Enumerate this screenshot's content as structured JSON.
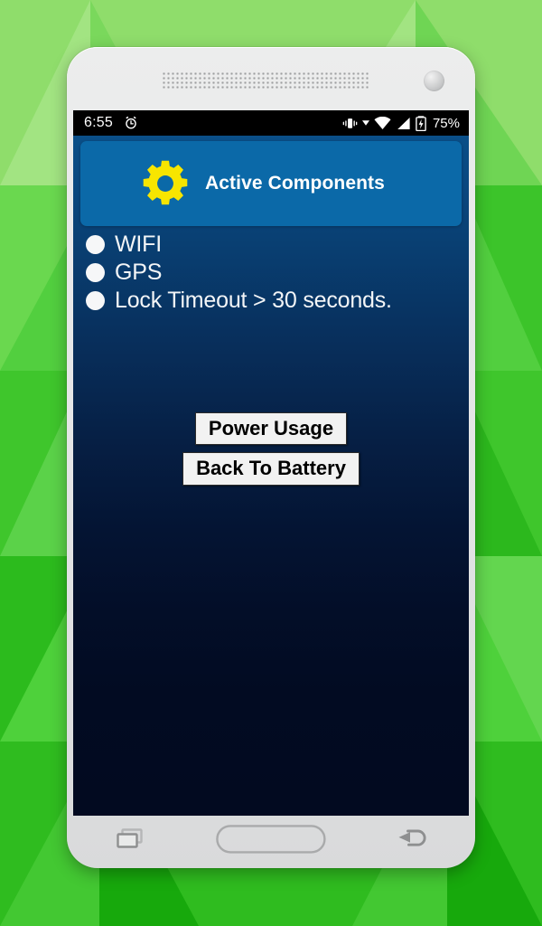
{
  "background": {
    "style": "green-low-poly-triangles",
    "base_color": "#4ecb3c"
  },
  "device": {
    "body_color": "#e7e8e9",
    "speaker_grille": "speaker-grille",
    "camera": "front-camera"
  },
  "status_bar": {
    "clock": "6:55",
    "alarm_icon": "alarm-clock-icon",
    "vibrate_icon": "vibrate-icon",
    "dropdown_icon": "caret-down-icon",
    "wifi_icon": "wifi-icon",
    "signal_icon": "cellular-signal-icon",
    "battery_icon": "battery-charging-icon",
    "battery_percent": "75%"
  },
  "header": {
    "icon": "gear-icon",
    "icon_color": "#f5e400",
    "title": "Active Components",
    "card_color": "#0b69a8"
  },
  "list": {
    "items": [
      {
        "bullet": "bullet-icon",
        "label": "WIFI"
      },
      {
        "bullet": "bullet-icon",
        "label": "GPS"
      },
      {
        "bullet": "bullet-icon",
        "label": "Lock Timeout > 30 seconds."
      }
    ]
  },
  "buttons": {
    "power_usage": "Power Usage",
    "back_to_battery": "Back To Battery"
  },
  "nav_bar": {
    "recents": "recents-icon",
    "home": "home-icon",
    "back": "back-icon"
  }
}
